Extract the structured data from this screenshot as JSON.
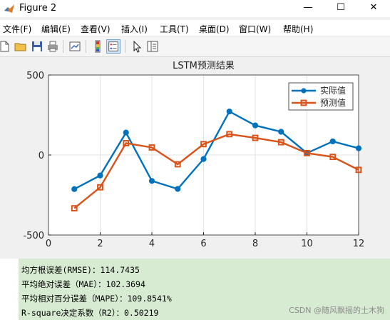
{
  "window": {
    "title": "Figure 2",
    "minimize": "—",
    "maximize": "☐",
    "close": "✕"
  },
  "menu": [
    "文件(F)",
    "编辑(E)",
    "查看(V)",
    "插入(I)",
    "工具(T)",
    "桌面(D)",
    "窗口(W)",
    "帮助(H)"
  ],
  "toolbar": {
    "icons": [
      "new-figure-icon",
      "open-folder-icon",
      "save-icon",
      "print-icon",
      "link-plot-icon",
      "colorbar-icon",
      "legend-icon",
      "pointer-arrow-icon",
      "property-inspector-icon"
    ]
  },
  "chart_data": {
    "type": "line",
    "title": "LSTM预测结果",
    "xlabel": "",
    "ylabel": "",
    "x": [
      1,
      2,
      3,
      4,
      5,
      6,
      7,
      8,
      9,
      10,
      11,
      12
    ],
    "xlim": [
      0,
      12
    ],
    "ylim": [
      -500,
      500
    ],
    "xticks": [
      0,
      2,
      4,
      6,
      8,
      10,
      12
    ],
    "yticks": [
      -500,
      0,
      500
    ],
    "grid": true,
    "legend_position": "top-right",
    "series": [
      {
        "name": "实际值",
        "color": "#0072bd",
        "marker": "circle",
        "values": [
          -213,
          -128,
          140,
          -162,
          -212,
          -25,
          272,
          185,
          145,
          12,
          85,
          42
        ]
      },
      {
        "name": "预测值",
        "color": "#d95319",
        "marker": "square",
        "values": [
          -333,
          -202,
          74,
          47,
          -58,
          68,
          130,
          107,
          80,
          12,
          -12,
          -93
        ]
      }
    ]
  },
  "console": {
    "lines": [
      "均方根误差(RMSE)：114.7435",
      "平均绝对误差（MAE）：102.3694",
      "平均相对百分误差（MAPE）：109.8541%",
      "R-square决定系数（R2）：0.50219"
    ]
  },
  "watermark": "CSDN @随风飘摇的土木狗"
}
